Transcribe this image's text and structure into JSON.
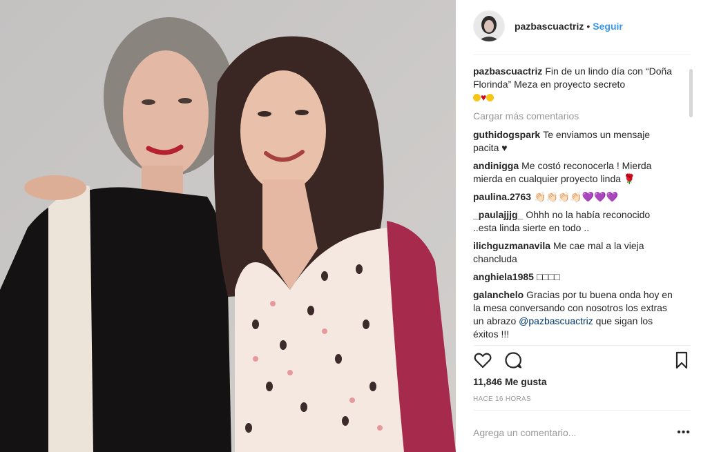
{
  "post": {
    "username": "pazbascuactriz",
    "follow_label": "Seguir",
    "separator": "•",
    "caption": "Fin de un lindo día con “Doña Florinda” Meza en proyecto secreto",
    "load_more": "Cargar más comentarios",
    "comments": [
      {
        "user": "guthidogspark",
        "text": "Te enviamos un mensaje pacita ♥"
      },
      {
        "user": "andinigga",
        "text": "Me costó reconocerla ! Mierda mierda en cualquier proyecto linda 🌹"
      },
      {
        "user": "paulina.2763",
        "text": "👏🏻👏🏻👏🏻👏🏻💜💜💜"
      },
      {
        "user": "_paulajjjg_",
        "text": "Ohhh no la había reconocido ..esta linda sierte en todo .."
      },
      {
        "user": "ilichguzmanavila",
        "text": "Me cae mal a la vieja chancluda"
      },
      {
        "user": "anghiela1985",
        "text": "□□□□"
      }
    ],
    "last_comment": {
      "user": "galanchelo",
      "text": "Gracias por tu buena onda hoy en la mesa conversando con nosotros los extras un abrazo",
      "mention": "@pazbascuactriz",
      "text_after": "que sigan los éxitos !!!"
    },
    "likes": "11,846 Me gusta",
    "time": "HACE 16 HORAS",
    "add_comment_placeholder": "Agrega un comentario...",
    "more_label": "•••",
    "icons": [
      "heart-icon",
      "comment-icon",
      "bookmark-icon"
    ]
  }
}
